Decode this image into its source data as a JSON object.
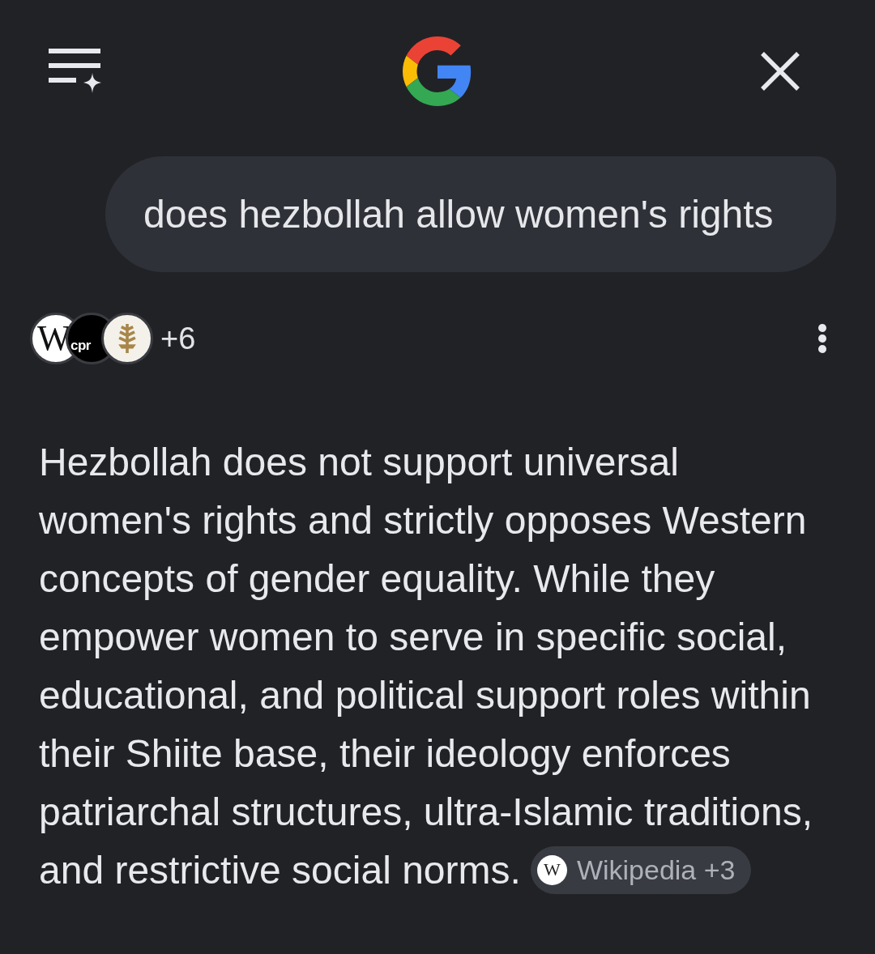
{
  "query": "does hezbollah allow women's rights",
  "sources": {
    "favicons": [
      {
        "kind": "letter",
        "glyph": "W"
      },
      {
        "kind": "wordmark",
        "glyph": "cpr"
      },
      {
        "kind": "emblem"
      }
    ],
    "more": "+6"
  },
  "answer": {
    "text": "Hezbollah does not support universal women's rights and strictly opposes Western concepts of gender equality. While they empower women to serve in specific social, educational, and political support roles within their Shiite base, their ideology enforces patriarchal structures, ultra-Islamic traditions, and restrictive social norms.",
    "citation": {
      "glyph": "W",
      "label": "Wikipedia +3"
    }
  }
}
